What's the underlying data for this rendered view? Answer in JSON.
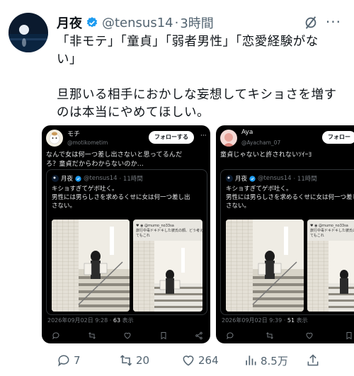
{
  "tweet": {
    "display_name": "月夜",
    "handle": "@tensus14",
    "separator": "·",
    "time_ago": "3時間",
    "body_line1": "「非モテ」「童貞」「弱者男性」「恋愛経験がな",
    "body_line2": "い」",
    "body_line3": "旦那いる相手におかしな妄想してキショさを増す",
    "body_line4": "のは本当にやめてほしい。",
    "replies": "7",
    "reposts": "20",
    "likes": "264",
    "views": "8.5万"
  },
  "card1": {
    "name": "モチ",
    "handle": "@motikometim",
    "follow": "フォローする",
    "text_line1": "なんで女は何一つ差し出さないと思ってるんだ",
    "text_line2": "ろ？童貞だからわからないのか...",
    "quote_name": "月夜",
    "quote_handle": "@tensus14",
    "quote_time": "· 11時間",
    "quote_line1": "キショすぎてゲボ吐く。",
    "quote_line2": "男性には男らしさを求めるくせに女は何一つ差し出",
    "quote_line3": "さない。",
    "date": "2026年09月02日 9:28 ·",
    "views": "63",
    "views_label": "表示"
  },
  "card2": {
    "name": "Aya",
    "handle": "@Ayacham_07",
    "follow": "フォロー",
    "text_line1": "童貞じゃないと許されないｿｲｰﾖ",
    "quote_name": "月夜",
    "quote_handle": "@tensus14",
    "quote_time": "· 11時間",
    "quote_line1": "キショすぎてゲボ吐く。",
    "quote_line2": "男性には男らしさを求めるくせに女は何一つ差し出",
    "quote_line3": "さない。",
    "date": "2026年09月02日 9:39 ·",
    "views": "51",
    "views_label": "表示"
  },
  "colors": {
    "text": "#0f1419",
    "secondary": "#536471",
    "verified": "#1d9bf0",
    "card_bg": "#000000"
  }
}
